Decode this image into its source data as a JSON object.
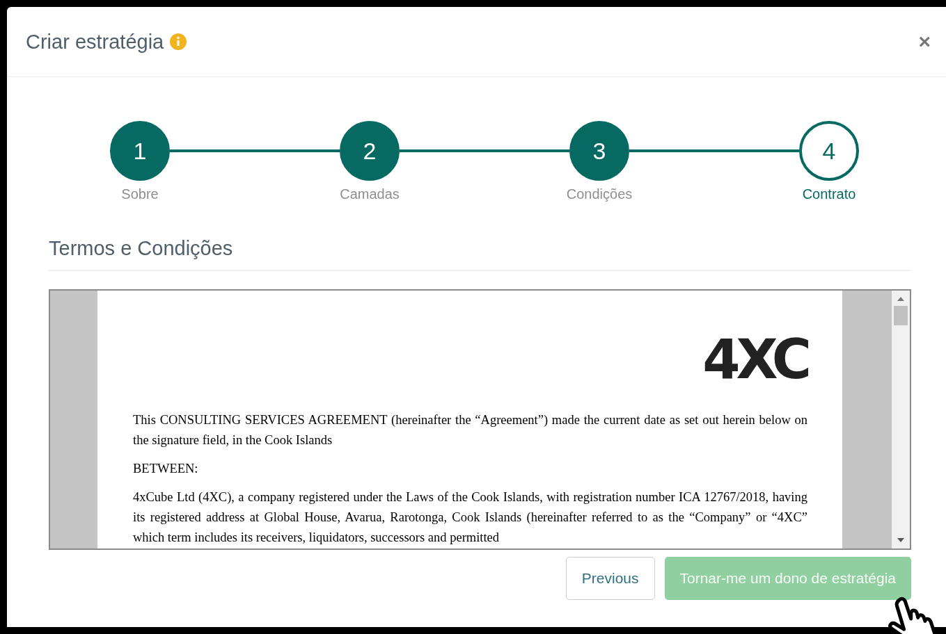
{
  "dialog": {
    "title": "Criar estratégia",
    "close_label": "×"
  },
  "steps": [
    {
      "number": "1",
      "label": "Sobre",
      "completed": true,
      "selected": false
    },
    {
      "number": "2",
      "label": "Camadas",
      "completed": true,
      "selected": false
    },
    {
      "number": "3",
      "label": "Condições",
      "completed": true,
      "selected": false
    },
    {
      "number": "4",
      "label": "Contrato",
      "completed": false,
      "selected": true
    }
  ],
  "section": {
    "title": "Termos e Condições"
  },
  "document": {
    "logo": "4XC",
    "paragraphs": [
      "This CONSULTING SERVICES AGREEMENT (hereinafter the “Agreement”) made the current date as set out herein below on the signature field, in the Cook Islands",
      "BETWEEN:",
      "4xCube Ltd (4XC), a company registered under the Laws of the Cook Islands, with registration number ICA 12767/2018, having its registered address at Global House, Avarua, Rarotonga, Cook Islands (hereinafter referred to as the “Company” or “4XC” which term includes its receivers, liquidators, successors and permitted"
    ]
  },
  "buttons": [
    {
      "label": "Previous",
      "kind": "secondary",
      "disabled": false
    },
    {
      "label": "Tornar-me um dono de estratégia",
      "kind": "primary",
      "disabled": true
    }
  ]
}
